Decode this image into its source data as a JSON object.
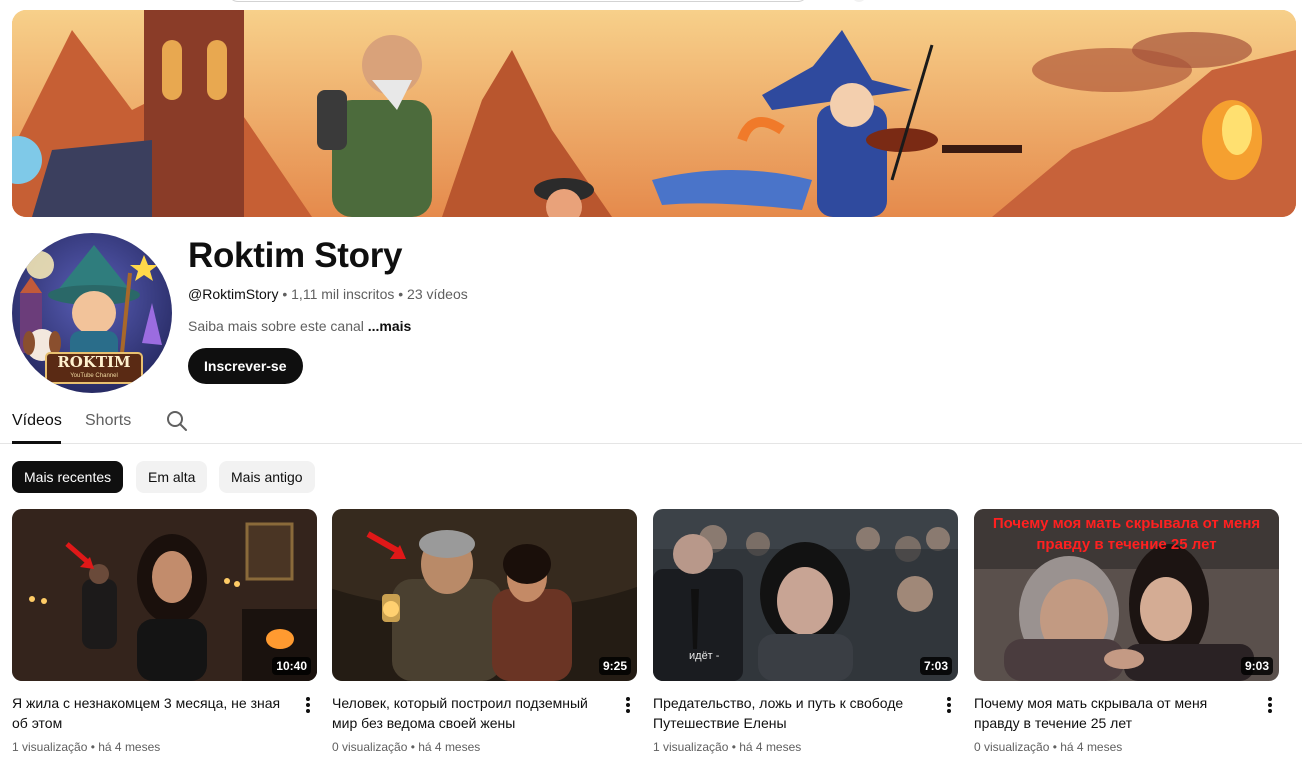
{
  "channel": {
    "name": "Roktim Story",
    "handle": "@RoktimStory",
    "subscribers": "1,11 mil inscritos",
    "video_count": "23 vídeos",
    "separator": " • ",
    "about": "Saiba mais sobre este canal",
    "about_more": "...mais",
    "subscribe_label": "Inscrever-se",
    "avatar_logo_text": "ROKTIM",
    "avatar_logo_sub": "YouTube Channel"
  },
  "tabs": [
    {
      "label": "Vídeos",
      "active": true
    },
    {
      "label": "Shorts",
      "active": false
    }
  ],
  "tab_search_icon": "search-icon",
  "chips": [
    {
      "label": "Mais recentes",
      "active": true
    },
    {
      "label": "Em alta",
      "active": false
    },
    {
      "label": "Mais antigo",
      "active": false
    }
  ],
  "videos": [
    {
      "title": "Я жила с незнакомцем 3 месяца, не зная об этом",
      "duration": "10:40",
      "views": "1 visualização",
      "age": "há 4 meses"
    },
    {
      "title": "Человек, который построил подземный мир без ведома своей жены",
      "duration": "9:25",
      "views": "0 visualização",
      "age": "há 4 meses"
    },
    {
      "title": "Предательство, ложь и путь к свободе Путешествие Елены",
      "duration": "7:03",
      "views": "1 visualização",
      "age": "há 4 meses",
      "thumb_text": "идёт -"
    },
    {
      "title": "Почему моя мать скрывала от меня правду в течение 25 лет",
      "duration": "9:03",
      "views": "0 visualização",
      "age": "há 4 meses",
      "thumb_text": "Почему моя мать скрывала от меня правду в течение 25 лет"
    }
  ],
  "colors": {
    "text_primary": "#0f0f0f",
    "text_secondary": "#606060",
    "chip_bg": "#f2f2f2",
    "active_bg": "#0f0f0f",
    "thumb_red_text": "#ff2020"
  }
}
